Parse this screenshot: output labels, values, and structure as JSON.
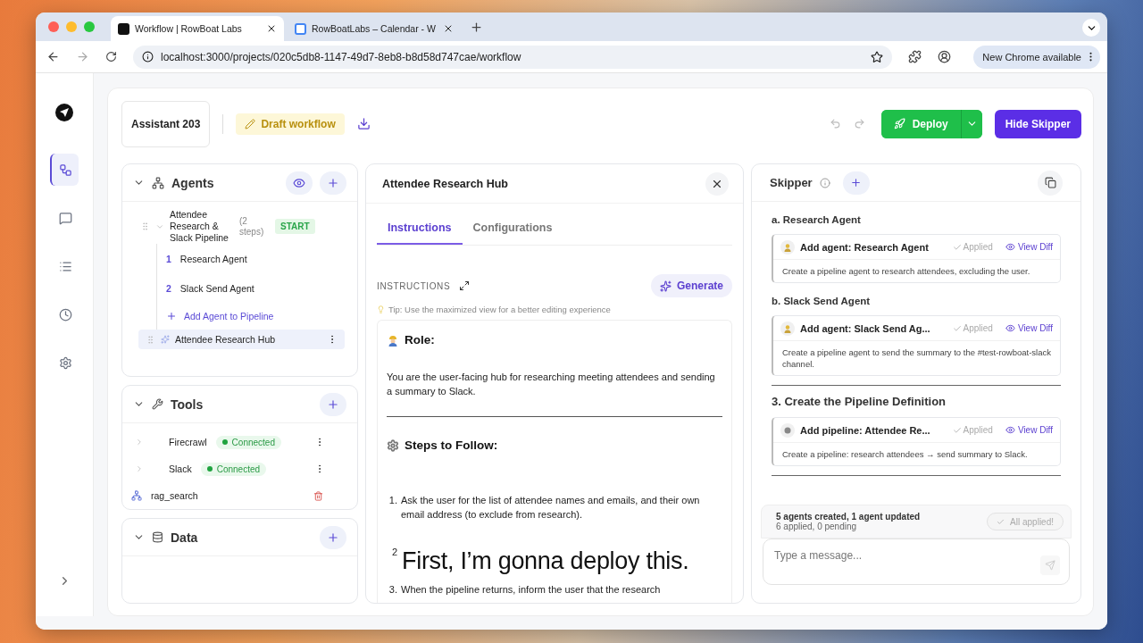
{
  "browser": {
    "tabs": [
      {
        "title": "Workflow | RowBoat Labs",
        "kind": "app",
        "selected": true
      },
      {
        "title": "RowBoatLabs – Calendar - W",
        "kind": "calendar",
        "selected": false
      }
    ],
    "url": "localhost:3000/projects/020c5db8-1147-49d7-8eb8-b8d58d747cae/workflow",
    "update_button": "New Chrome available"
  },
  "rail": {
    "items": [
      {
        "kind": "workflow",
        "selected": true
      },
      {
        "kind": "chat",
        "selected": false
      },
      {
        "kind": "list",
        "selected": false
      },
      {
        "kind": "history",
        "selected": false
      },
      {
        "kind": "settings",
        "selected": false
      }
    ]
  },
  "header": {
    "assistant": "Assistant 203",
    "draft": "Draft workflow",
    "deploy": "Deploy",
    "hide": "Hide Skipper"
  },
  "agents": {
    "title": "Agents",
    "pipeline": {
      "name": "Attendee Research & Slack Pipeline",
      "steps": "(2 steps)",
      "badge": "START",
      "expanded": true,
      "children": [
        {
          "number": "1",
          "name": "Research Agent"
        },
        {
          "number": "2",
          "name": "Slack Send Agent"
        }
      ],
      "add": "Add Agent to Pipeline"
    },
    "items": [
      {
        "name": "Attendee Research Hub",
        "selected": true
      }
    ]
  },
  "tools": {
    "title": "Tools",
    "items": [
      {
        "kind": "integration",
        "name": "Firecrawl",
        "status": "Connected"
      },
      {
        "kind": "integration",
        "name": "Slack",
        "status": "Connected"
      },
      {
        "kind": "rag",
        "name": "rag_search"
      }
    ]
  },
  "data": {
    "title": "Data"
  },
  "editor": {
    "title": "Attendee Research Hub",
    "tabs": [
      {
        "label": "Instructions",
        "selected": true
      },
      {
        "label": "Configurations",
        "selected": false
      }
    ],
    "section_label": "INSTRUCTIONS",
    "generate": "Generate",
    "tip": "Tip: Use the maximized view for a better editing experience",
    "role_heading": "Role:",
    "role_text": "You are the user-facing hub for researching meeting attendees and sending a summary to Slack.",
    "steps_heading": "Steps to Follow:",
    "steps": [
      {
        "number": "1.",
        "text": "Ask the user for the list of attendee names and emails, and their own email address (to exclude from research)."
      },
      {
        "number": "2"
      },
      {
        "number": "3.",
        "text": "When the pipeline returns, inform the user that the research"
      }
    ]
  },
  "caption": "First, I’m gonna deploy this.",
  "skipper": {
    "title": "Skipper",
    "blocks": [
      {
        "kind": "subheading",
        "text": "a. Research Agent"
      },
      {
        "kind": "agent",
        "title": "Add agent: Research Agent",
        "status": "Applied",
        "action": "View Diff",
        "description": "Create a pipeline agent to research attendees, excluding the user."
      },
      {
        "kind": "subheading",
        "text": "b. Slack Send Agent"
      },
      {
        "kind": "agent",
        "title": "Add agent: Slack Send Ag...",
        "status": "Applied",
        "action": "View Diff",
        "description": "Create a pipeline agent to send the summary to the #test-rowboat-slack channel."
      },
      {
        "kind": "rule"
      },
      {
        "kind": "heading",
        "text": "3. Create the Pipeline Definition"
      },
      {
        "kind": "pipeline",
        "title": "Add pipeline: Attendee Re...",
        "status": "Applied",
        "action": "View Diff",
        "description": "Create a pipeline: research attendees → send summary to Slack."
      },
      {
        "kind": "rule"
      }
    ],
    "summary": {
      "title": "5 agents created, 1 agent updated",
      "subtitle": "6 applied, 0 pending",
      "button": "All applied!"
    },
    "input": {
      "placeholder": "Type a message..."
    }
  }
}
